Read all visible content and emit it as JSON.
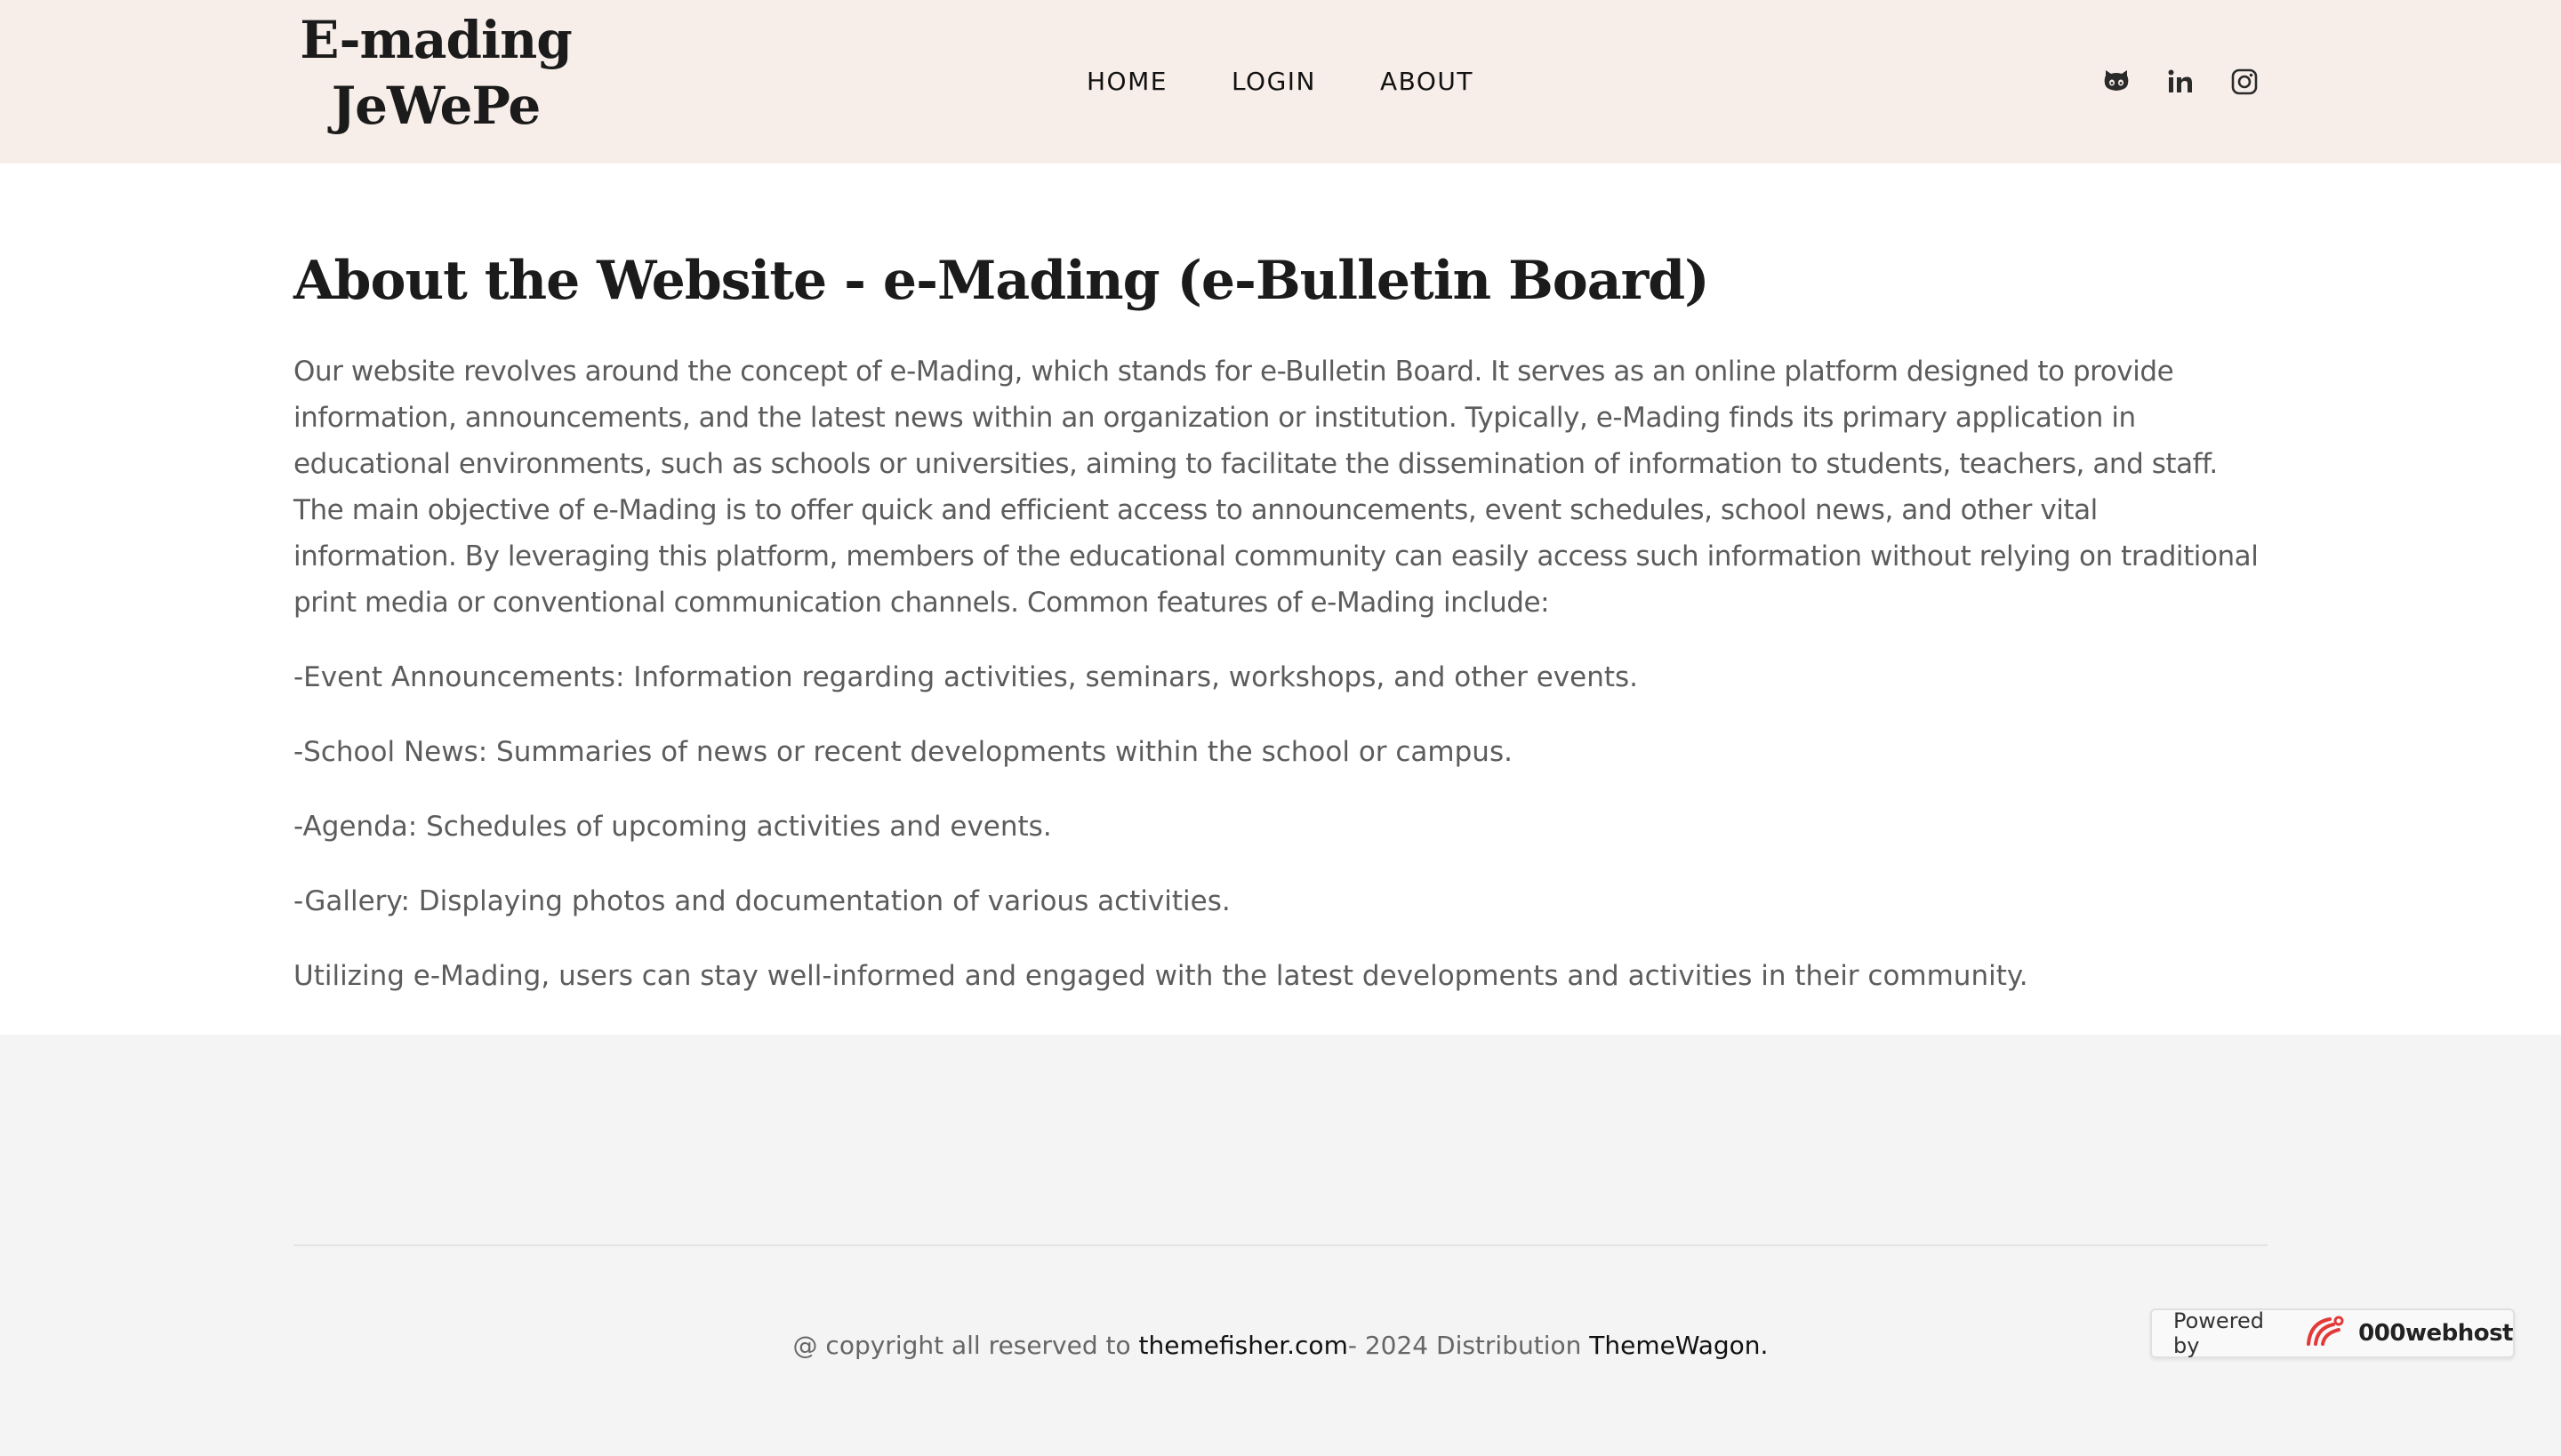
{
  "header": {
    "logo_line1": "E-mading",
    "logo_line2": "JeWePe",
    "nav": [
      {
        "label": "HOME"
      },
      {
        "label": "LOGIN"
      },
      {
        "label": "ABOUT"
      }
    ],
    "social_icons": [
      "github-icon",
      "linkedin-icon",
      "instagram-icon"
    ]
  },
  "main": {
    "title": "About the Website - e-Mading (e-Bulletin Board)",
    "intro": "Our website revolves around the concept of e-Mading, which stands for e-Bulletin Board. It serves as an online platform designed to provide information, announcements, and the latest news within an organization or institution. Typically, e-Mading finds its primary application in educational environments, such as schools or universities, aiming to facilitate the dissemination of information to students, teachers, and staff. The main objective of e-Mading is to offer quick and efficient access to announcements, event schedules, school news, and other vital information. By leveraging this platform, members of the educational community can easily access such information without relying on traditional print media or conventional communication channels. Common features of e-Mading include:",
    "features": [
      "-Event Announcements: Information regarding activities, seminars, workshops, and other events.",
      "-School News: Summaries of news or recent developments within the school or campus.",
      "-Agenda: Schedules of upcoming activities and events.",
      "-Gallery: Displaying photos and documentation of various activities."
    ],
    "closing": "Utilizing e-Mading, users can stay well-informed and engaged with the latest developments and activities in their community."
  },
  "footer": {
    "copyright_prefix": "@ copyright all reserved to ",
    "link1": "themefisher.com",
    "middle": "- 2024 Distribution ",
    "link2": "ThemeWagon."
  },
  "badge": {
    "label": "Powered by",
    "brand": "000webhost"
  },
  "colors": {
    "header_bg": "#f8eee9",
    "footer_bg": "#f4f4f4",
    "body_text": "#5c5c5c",
    "badge_logo": "#e23a3a"
  }
}
